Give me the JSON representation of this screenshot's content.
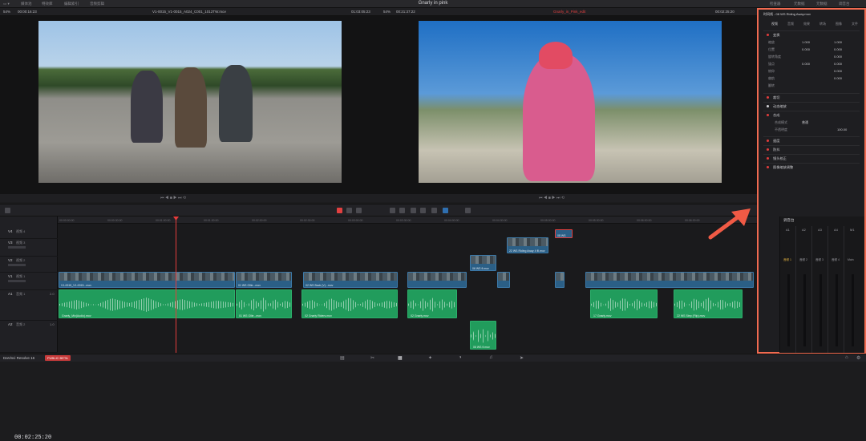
{
  "app": {
    "name": "DaVinci Resolve 16",
    "badge": "PUBLIC BETA"
  },
  "project_title": "Gnarly in pink",
  "topbar": {
    "items": [
      "媒体池",
      "特效库",
      "编辑索引",
      "音频剪辑"
    ],
    "right_items": [
      "检查器",
      "元数据",
      "元数据",
      "调音台"
    ]
  },
  "source_viewer": {
    "zoom": "54%",
    "timecode": "00:00:16:23",
    "clip_name": "V1-0015_V1-0015_A024_C001_1012TW.mov",
    "duration_tc": "01:03:05:23"
  },
  "timeline_viewer": {
    "zoom": "54%",
    "timecode": "00:21:37:22",
    "timeline_name": "Gnarly_in_Pink_edit",
    "out_tc": "00:02:25:20",
    "accent": "#e24040"
  },
  "timeline": {
    "timecode": "00:02:25:20",
    "ruler_ticks": [
      "00:00:00:00",
      "00:00:30:00",
      "00:01:00:00",
      "00:01:30:00",
      "00:02:00:00",
      "00:02:30:00",
      "00:03:00:00",
      "00:03:30:00",
      "00:04:00:00",
      "00:04:30:00",
      "00:05:00:00",
      "00:05:30:00",
      "00:06:00:00",
      "00:06:30:00"
    ],
    "tracks": [
      {
        "id": "V4",
        "name": "视频 4"
      },
      {
        "id": "V3",
        "name": "视频 3"
      },
      {
        "id": "V2",
        "name": "视频 2"
      },
      {
        "id": "V1",
        "name": "视频 1"
      },
      {
        "id": "A1",
        "name": "音频 1",
        "level": "2.0"
      },
      {
        "id": "A2",
        "name": "音频 2",
        "level": "1.0"
      }
    ],
    "clip_labels": {
      "v4": "08 WS",
      "v3a": "22 WS Riding Away 4 fll.mov",
      "v2a": "06 WS fl.mov",
      "v1a": "V1-0015_V1-0015...mov",
      "v1b": "01 WS Ollie...mov",
      "v1c": "02 WS Back (V)...mov",
      "a1a": "Gnarly_Mix(Audio).mov",
      "a1b": "01 WS Ollie...mov",
      "a1c": "02 Gnarly Riders.mov",
      "a1d": "02 Gnarly.mov",
      "a1e": "17 Gnarly.mov",
      "a1f": "22 WS Step (Flip).mov",
      "a2a": "06 WS fl.mov"
    },
    "accent_video": "#2b5f86",
    "accent_audio": "#219c5c"
  },
  "inspector": {
    "title": "时间线 - 08 WS Riding Away.mov",
    "tabs": [
      "视频",
      "音频",
      "效果",
      "转场",
      "图像",
      "文件"
    ],
    "sections": [
      "变换",
      "裁切",
      "动态缩放",
      "合成",
      "速度",
      "防抖",
      "镜头校正",
      "图像缩放调整"
    ],
    "transform_rows": [
      {
        "label": "缩放",
        "x": "1.000",
        "y": "1.000"
      },
      {
        "label": "位置",
        "x": "0.000",
        "y": "0.000"
      },
      {
        "label": "旋转角度",
        "x": "0.000",
        "y": ""
      },
      {
        "label": "锚点",
        "x": "0.000",
        "y": "0.000"
      },
      {
        "label": "俯仰",
        "x": "0.000",
        "y": ""
      },
      {
        "label": "偏航",
        "x": "0.000",
        "y": ""
      },
      {
        "label": "翻转",
        "x": "",
        "y": ""
      }
    ],
    "composite": {
      "mode_label": "合成模式",
      "mode": "普通",
      "opacity_label": "不透明度",
      "opacity": "100.00"
    },
    "border_color": "#f06a50"
  },
  "mixer": {
    "title": "调音台",
    "channels": [
      "A1",
      "A2",
      "A3",
      "A4",
      "M1"
    ],
    "channel_names": [
      "音频 1",
      "音频 2",
      "音频 3",
      "音频 4",
      "Main"
    ]
  },
  "bottom_nav": [
    "media",
    "cut",
    "edit",
    "fusion",
    "color",
    "fairlight",
    "deliver"
  ]
}
